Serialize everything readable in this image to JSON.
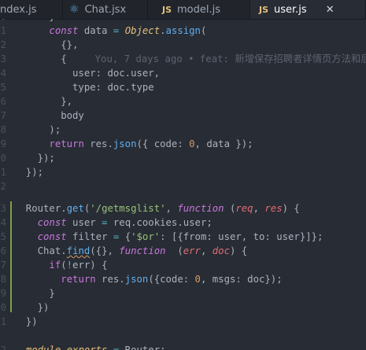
{
  "tabs": [
    {
      "label": "ndex.js",
      "icon": "js-file-icon",
      "badge": ""
    },
    {
      "label": "Chat.jsx",
      "icon": "react-file-icon",
      "badge": "⚛"
    },
    {
      "label": "model.js",
      "icon": "js-file-icon",
      "badge": "JS"
    },
    {
      "label": "user.js",
      "icon": "js-file-icon",
      "badge": "JS",
      "active": true,
      "close": "✕"
    }
  ],
  "gutter": [
    "0",
    "1",
    "2",
    "3",
    "4",
    "5",
    "6",
    "7",
    "8",
    "9",
    "0",
    "1",
    "2",
    "3",
    "4",
    "5",
    "6",
    "7",
    "8",
    "9",
    "0",
    "1",
    "2",
    "3",
    "4"
  ],
  "blame_text": "You, 7 days ago • feat: 新增保存招聘者详情页方法和后"
}
